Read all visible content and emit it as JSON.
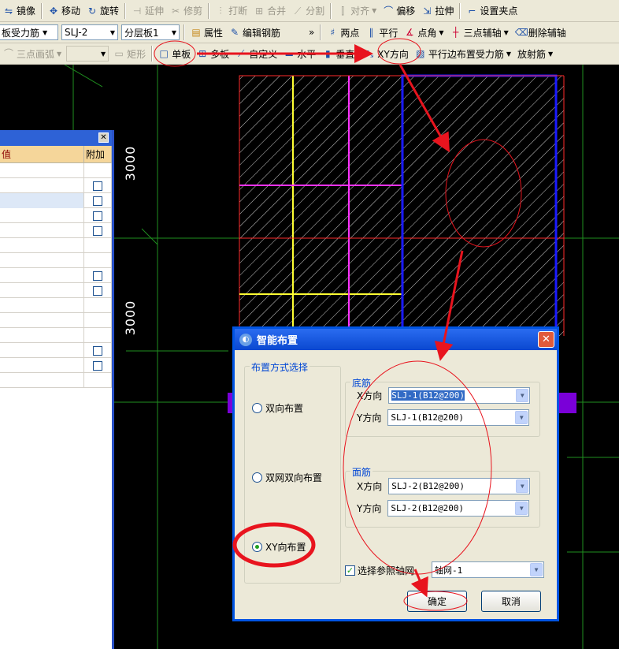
{
  "toolbar1": {
    "mirror": "镜像",
    "move": "移动",
    "rotate": "旋转",
    "extend": "延伸",
    "trim": "修剪",
    "break": "打断",
    "merge": "合并",
    "split": "分割",
    "align": "对齐",
    "offset": "偏移",
    "stretch": "拉伸",
    "set_grip": "设置夹点"
  },
  "toolbar2": {
    "element_type": "板受力筋",
    "rebar_name": "SLJ-2",
    "layer": "分层板1",
    "properties": "属性",
    "edit_rebar": "编辑钢筋",
    "two_points": "两点",
    "parallel": "平行",
    "point_angle": "点角",
    "three_point_aux": "三点辅轴",
    "delete_aux": "删除辅轴"
  },
  "toolbar3": {
    "three_point_arc": "三点画弧",
    "rect": "矩形",
    "single_slab": "单板",
    "multi_slab": "多板",
    "custom": "自定义",
    "horizontal": "水平",
    "vertical": "垂直",
    "xy_direction": "XY方向",
    "parallel_edge": "平行边布置受力筋",
    "radial": "放射筋"
  },
  "canvas": {
    "dim_upper": "3000",
    "dim_lower": "3000"
  },
  "panel": {
    "col_value": "值",
    "col_attach": "附加",
    "rows": [
      {
        "attach": false
      },
      {
        "attach": true
      },
      {
        "attach": true
      },
      {
        "attach": true
      },
      {
        "attach": true
      },
      {
        "attach": false
      },
      {
        "attach": false
      },
      {
        "attach": true
      },
      {
        "attach": true
      },
      {
        "attach": false
      },
      {
        "attach": false
      },
      {
        "attach": false
      },
      {
        "attach": true
      },
      {
        "attach": true
      },
      {
        "attach": false
      }
    ]
  },
  "dialog": {
    "title": "智能布置",
    "mode_group": "布置方式选择",
    "modes": [
      "双向布置",
      "双网双向布置",
      "XY向布置"
    ],
    "selected_mode": 2,
    "bottom_group": "底筋",
    "top_group": "面筋",
    "x_label": "X方向",
    "y_label": "Y方向",
    "bottom_x": "SLJ-1(B12@200)",
    "bottom_y": "SLJ-1(B12@200)",
    "top_x": "SLJ-2(B12@200)",
    "top_y": "SLJ-2(B12@200)",
    "ref_axis_label": "选择参照轴网",
    "ref_axis_checked": true,
    "ref_axis_value": "轴网-1",
    "ok": "确定",
    "cancel": "取消"
  },
  "colors": {
    "annotation": "#e8141e",
    "slab_blue": "#1a1aff",
    "beam_magenta": "#ff33ff",
    "beam_yellow": "#ffff33"
  }
}
